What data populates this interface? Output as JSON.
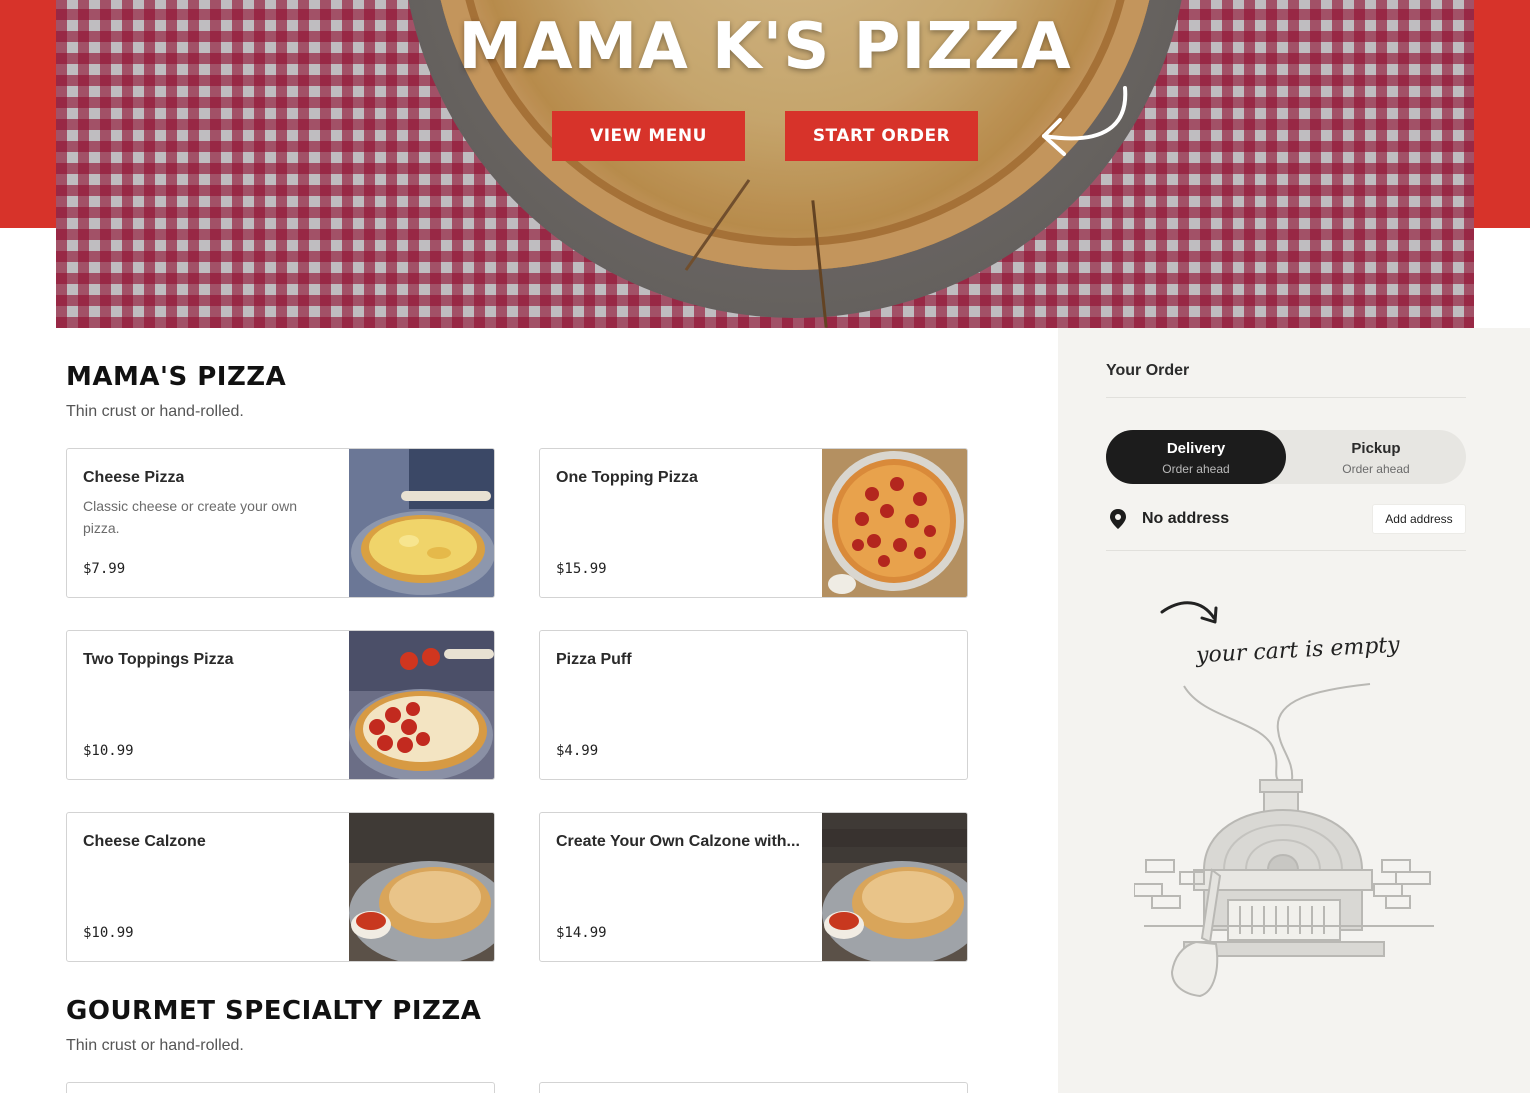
{
  "hero": {
    "title": "MAMA K'S PIZZA",
    "buttons": {
      "view_menu": "VIEW MENU",
      "start_order": "START ORDER"
    },
    "accent_color": "#d7332a"
  },
  "sections": [
    {
      "title": "MAMA'S PIZZA",
      "description": "Thin crust or hand-rolled.",
      "items": [
        {
          "name": "Cheese Pizza",
          "description": "Classic cheese or create your own pizza.",
          "price": "$7.99",
          "image": "cheese-pizza-photo"
        },
        {
          "name": "One Topping Pizza",
          "description": "",
          "price": "$15.99",
          "image": "pepperoni-pizza-photo"
        },
        {
          "name": "Two Toppings Pizza",
          "description": "",
          "price": "$10.99",
          "image": "half-pepperoni-pizza-photo"
        },
        {
          "name": "Pizza Puff",
          "description": "",
          "price": "$4.99",
          "image": ""
        },
        {
          "name": "Cheese Calzone",
          "description": "",
          "price": "$10.99",
          "image": "calzone-photo"
        },
        {
          "name": "Create Your Own Calzone with...",
          "description": "",
          "price": "$14.99",
          "image": "create-your-own-calzone-photo"
        }
      ]
    },
    {
      "title": "GOURMET SPECIALTY PIZZA",
      "description": "Thin crust or hand-rolled."
    }
  ],
  "order": {
    "title": "Your Order",
    "modes": [
      {
        "label": "Delivery",
        "sub": "Order ahead",
        "active": true
      },
      {
        "label": "Pickup",
        "sub": "Order ahead",
        "active": false
      }
    ],
    "address": {
      "value": "No address",
      "button": "Add address",
      "icon": "location-pin-icon"
    },
    "empty_text": "your cart is empty",
    "illustration": "pizza-oven-illustration"
  }
}
